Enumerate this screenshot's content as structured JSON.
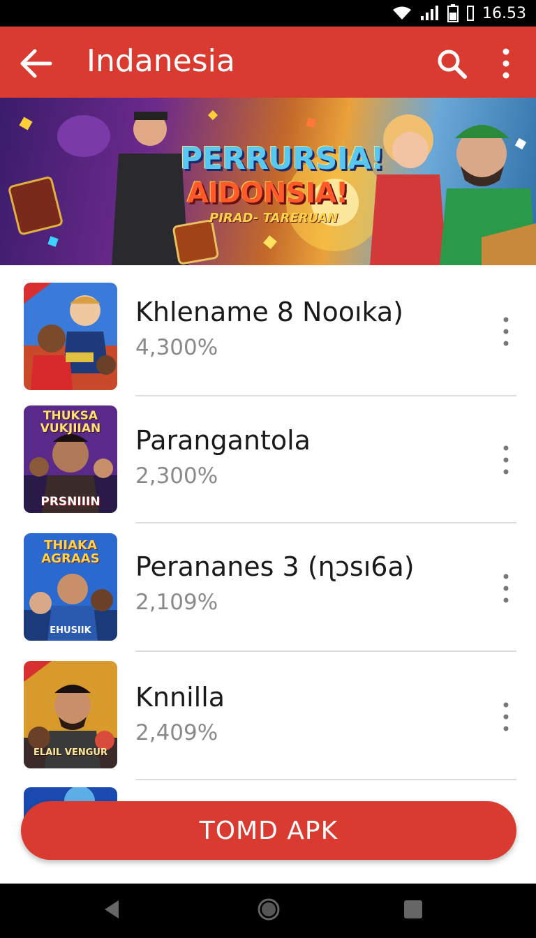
{
  "status_bar": {
    "time": "16.53"
  },
  "app_bar": {
    "title": "Indanesia"
  },
  "banner": {
    "line1": "PERRURSIA!",
    "line2": "AIDONSIA!",
    "line3": "PIRAD- TARERUAN"
  },
  "thumbnails": [
    {
      "caption_top": "",
      "caption_bottom": ""
    },
    {
      "caption_top": "THUKSA VUKJIIAN",
      "caption_bottom": "PRSNIIIN"
    },
    {
      "caption_top": "THIAKA AGRAAS",
      "caption_bottom": "EHUSIIK"
    },
    {
      "caption_top": "",
      "caption_bottom": "ELAIL VENGUR"
    }
  ],
  "list": [
    {
      "title": "Khlename 8 Nooıka)",
      "subtitle": "4,300%"
    },
    {
      "title": "Parangantola",
      "subtitle": "2,300%"
    },
    {
      "title": "Perananes 3 (ɳɔsı6a)",
      "subtitle": "2,109%"
    },
    {
      "title": "Knnilla",
      "subtitle": "2,409%"
    }
  ],
  "cta": {
    "label": "TOMD APK"
  },
  "colors": {
    "primary": "#d93b30",
    "title_text": "#1a1a1a",
    "subtitle_text": "#8a8a8a"
  }
}
